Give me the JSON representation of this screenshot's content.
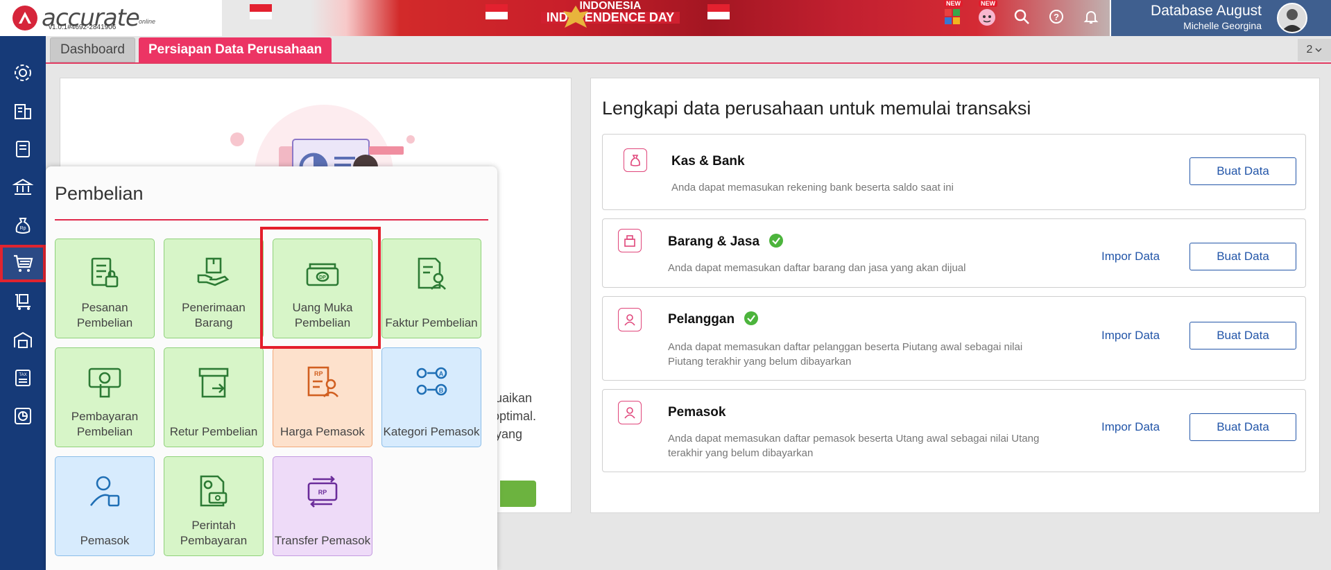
{
  "brand": {
    "name": "accurate",
    "tagline": "online",
    "version": "v1.0.1#4692-2841906"
  },
  "banner": {
    "line1": "INDONESIA",
    "line2": "INDEPENDENCE DAY"
  },
  "top_icons": [
    {
      "name": "apps-icon",
      "badge": "NEW"
    },
    {
      "name": "mascot-icon",
      "badge": "NEW"
    },
    {
      "name": "search-icon"
    },
    {
      "name": "help-icon"
    },
    {
      "name": "bell-icon"
    }
  ],
  "account": {
    "database": "Database August",
    "user": "Michelle Georgina"
  },
  "sidebar": {
    "items": [
      "settings",
      "company",
      "ledger",
      "bank",
      "sales",
      "purchase",
      "inventory",
      "warehouse",
      "tax",
      "report"
    ],
    "active_index": 5
  },
  "tabs": [
    {
      "label": "Dashboard",
      "active": false
    },
    {
      "label": "Persiapan Data Perusahaan",
      "active": true
    }
  ],
  "tab_count": "2",
  "left_panel": {
    "partial_lines": [
      "esuaikan",
      "h optimal.",
      "al yang"
    ]
  },
  "right_panel": {
    "title": "Lengkapi data perusahaan untuk memulai transaksi",
    "cards": [
      {
        "title": "Kas & Bank",
        "desc": "Anda dapat memasukan rekening bank beserta saldo saat ini",
        "done": false,
        "impor": "",
        "buat": "Buat Data"
      },
      {
        "title": "Barang & Jasa",
        "desc": "Anda dapat memasukan daftar barang dan jasa yang akan dijual",
        "done": true,
        "impor": "Impor Data",
        "buat": "Buat Data"
      },
      {
        "title": "Pelanggan",
        "desc": "Anda dapat memasukan daftar pelanggan beserta Piutang awal sebagai nilai Piutang terakhir yang belum dibayarkan",
        "done": true,
        "impor": "Impor Data",
        "buat": "Buat Data"
      },
      {
        "title": "Pemasok",
        "desc": "Anda dapat memasukan daftar pemasok beserta Utang awal sebagai nilai Utang terakhir yang belum dibayarkan",
        "done": false,
        "impor": "Impor Data",
        "buat": "Buat Data"
      }
    ]
  },
  "menu": {
    "title": "Pembelian",
    "tiles": [
      {
        "label": "Pesanan Pembelian",
        "color": "green",
        "icon": "purchase-order-icon"
      },
      {
        "label": "Penerimaan Barang",
        "color": "green",
        "icon": "receive-goods-icon"
      },
      {
        "label": "Uang Muka Pembelian",
        "color": "green",
        "icon": "down-payment-icon",
        "highlighted": true
      },
      {
        "label": "Faktur Pembelian",
        "color": "green",
        "icon": "purchase-invoice-icon"
      },
      {
        "label": "Pembayaran Pembelian",
        "color": "green",
        "icon": "purchase-payment-icon"
      },
      {
        "label": "Retur Pembelian",
        "color": "green",
        "icon": "purchase-return-icon"
      },
      {
        "label": "Harga Pemasok",
        "color": "orange",
        "icon": "supplier-price-icon"
      },
      {
        "label": "Kategori Pemasok",
        "color": "blue",
        "icon": "supplier-category-icon"
      },
      {
        "label": "Pemasok",
        "color": "blue",
        "icon": "supplier-icon"
      },
      {
        "label": "Perintah Pembayaran",
        "color": "green",
        "icon": "payment-order-icon"
      },
      {
        "label": "Transfer Pemasok",
        "color": "purple",
        "icon": "supplier-transfer-icon"
      }
    ]
  },
  "colors": {
    "accent": "#ec3464",
    "sidebar": "#163a78",
    "link": "#2255a8",
    "check": "#4cb43c",
    "highlight": "#e41e2b"
  }
}
